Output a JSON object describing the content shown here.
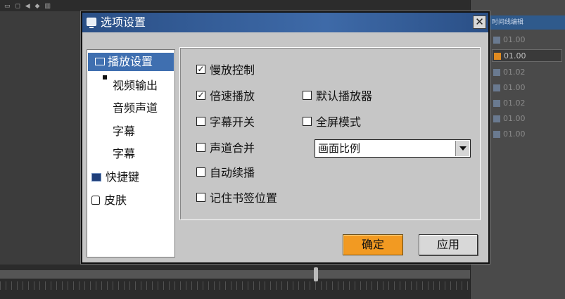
{
  "dialog": {
    "title": "选项设置",
    "close_symbol": "✕"
  },
  "nav": {
    "items": [
      {
        "label": "播放设置",
        "icon": "monitor-icon"
      },
      {
        "label": "视频输出"
      },
      {
        "label": "音频声道"
      },
      {
        "label": "字幕"
      },
      {
        "label": "字幕"
      },
      {
        "label": "快捷键",
        "icon": "keyboard-icon"
      },
      {
        "label": "皮肤",
        "icon": "skin-icon"
      }
    ]
  },
  "options": {
    "slow_play": {
      "label": "慢放控制",
      "checked": true
    },
    "speed_play": {
      "label": "倍速播放",
      "checked": true
    },
    "subtitle_switch": {
      "label": "字幕开关",
      "checked": false
    },
    "channel_merge": {
      "label": "声道合并",
      "checked": false
    },
    "auto_continue": {
      "label": "自动续播",
      "checked": false
    },
    "remember_bookmark": {
      "label": "记住书签位置",
      "checked": false
    },
    "default_player": {
      "label": "默认播放器",
      "checked": false
    },
    "fullscreen": {
      "label": "全屏模式",
      "checked": false
    },
    "aspect_select": {
      "value": "画面比例"
    }
  },
  "buttons": {
    "ok": "确定",
    "apply": "应用"
  },
  "background": {
    "panel_header": "时间线编辑",
    "tracks": [
      "01.00",
      "01.00",
      "01.02",
      "01.00",
      "01.02",
      "01.00",
      "01.00"
    ],
    "accent_color": "#f29a22",
    "title_color": "#2a4f86"
  }
}
